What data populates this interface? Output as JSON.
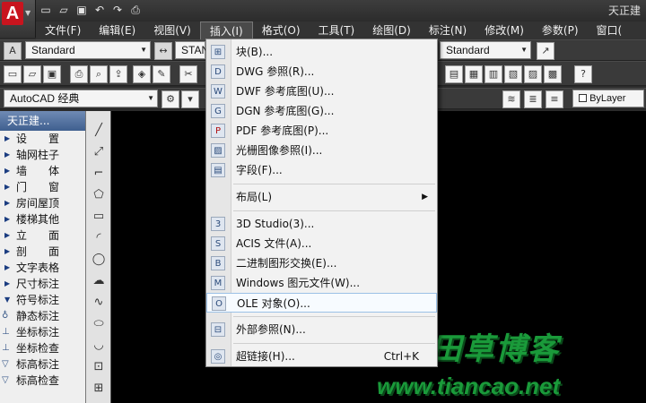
{
  "app": {
    "title": "天正建",
    "logo_letter": "A"
  },
  "quick_access": [
    "new-icon",
    "open-icon",
    "save-icon",
    "undo-icon",
    "redo-icon",
    "print-icon"
  ],
  "menubar": [
    "文件(F)",
    "编辑(E)",
    "视图(V)",
    "插入(I)",
    "格式(O)",
    "工具(T)",
    "绘图(D)",
    "标注(N)",
    "修改(M)",
    "参数(P)",
    "窗口("
  ],
  "toolbar1": {
    "text_style": "Standard",
    "dim_style": "STAN",
    "table_style": "Standard"
  },
  "toolbar3": {
    "workspace": "AutoCAD 经典",
    "layer_color": "ByLayer"
  },
  "left_panel": {
    "title": "天正建...",
    "items": [
      "设　　置",
      "轴网柱子",
      "墙　　体",
      "门　　窗",
      "房间屋顶",
      "楼梯其他",
      "立　　面",
      "剖　　面",
      "文字表格",
      "尺寸标注",
      "符号标注",
      "静态标注",
      "坐标标注",
      "坐标检查",
      "标高标注",
      "标高检查"
    ]
  },
  "insert_menu": {
    "items": [
      {
        "label": "块(B)...",
        "icon": "block-icon"
      },
      {
        "label": "DWG 参照(R)...",
        "icon": "dwg-icon"
      },
      {
        "label": "DWF 参考底图(U)...",
        "icon": "dwf-icon"
      },
      {
        "label": "DGN 参考底图(G)...",
        "icon": "dgn-icon"
      },
      {
        "label": "PDF 参考底图(P)...",
        "icon": "pdf-icon"
      },
      {
        "label": "光栅图像参照(I)...",
        "icon": "image-icon"
      },
      {
        "label": "字段(F)...",
        "icon": "field-icon"
      },
      {
        "label": "布局(L)",
        "submenu": true
      },
      {
        "label": "3D Studio(3)...",
        "icon": "3ds-icon"
      },
      {
        "label": "ACIS 文件(A)...",
        "icon": "acis-icon"
      },
      {
        "label": "二进制图形交换(E)...",
        "icon": "dxb-icon"
      },
      {
        "label": "Windows 图元文件(W)...",
        "icon": "wmf-icon"
      },
      {
        "label": "OLE 对象(O)...",
        "icon": "ole-icon"
      },
      {
        "label": "外部参照(N)...",
        "icon": "xref-icon"
      },
      {
        "label": "超链接(H)...",
        "icon": "hyperlink-icon",
        "shortcut": "Ctrl+K"
      }
    ]
  },
  "watermark": {
    "cn": "田草博客",
    "url": "www.tiancao.net"
  },
  "colors": {
    "background": "#2b2b2b",
    "drawing": "#000000",
    "menu": "#f2f2f2",
    "watermark": "#1a9a3a",
    "hover": "#9cc1e6"
  }
}
